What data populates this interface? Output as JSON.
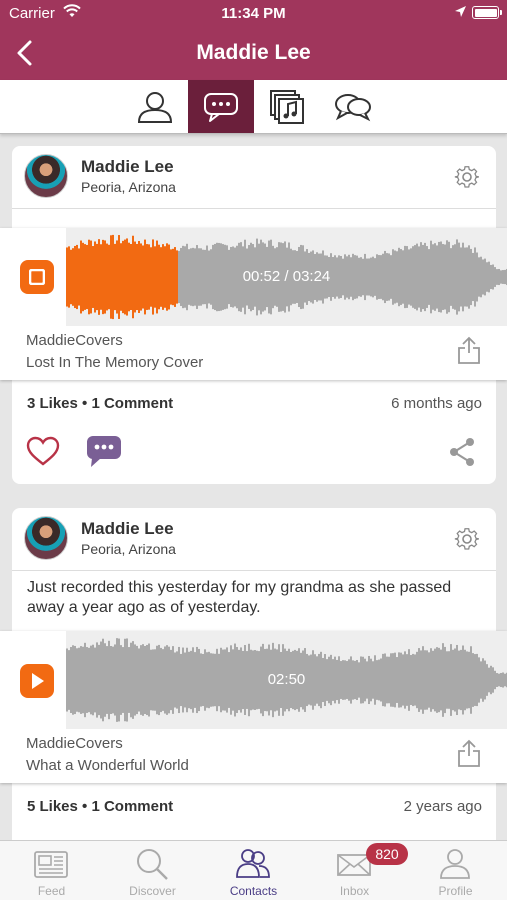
{
  "status_bar": {
    "carrier": "Carrier",
    "time": "11:34 PM"
  },
  "nav": {
    "title": "Maddie Lee"
  },
  "colors": {
    "brand": "#a0365c",
    "tab_active": "#6b1f3b",
    "accent": "#f26a12",
    "link_purple": "#7a5f95"
  },
  "tabs": [
    {
      "icon": "person-icon"
    },
    {
      "icon": "chat-bubble-icon",
      "active": true
    },
    {
      "icon": "music-library-icon"
    },
    {
      "icon": "conversations-icon"
    }
  ],
  "posts": [
    {
      "author": "Maddie Lee",
      "location": "Peoria, Arizona",
      "text": "",
      "time_display": "00:52 / 03:24",
      "progress": 0.25,
      "playing": true,
      "artist": "MaddieCovers",
      "track": "Lost In The Memory Cover",
      "stats": "3 Likes • 1 Comment",
      "ago": "6 months ago"
    },
    {
      "author": "Maddie Lee",
      "location": "Peoria, Arizona",
      "text": "Just recorded this yesterday for my grandma as she passed away a year ago as of yesterday.",
      "time_display": "02:50",
      "progress": 0,
      "playing": false,
      "artist": "MaddieCovers",
      "track": "What a Wonderful World",
      "stats": "5 Likes • 1 Comment",
      "ago": "2 years ago"
    }
  ],
  "tabbar": {
    "items": [
      {
        "label": "Feed",
        "icon": "feed-icon"
      },
      {
        "label": "Discover",
        "icon": "magnifier-icon"
      },
      {
        "label": "Contacts",
        "icon": "contacts-icon",
        "active": true
      },
      {
        "label": "Inbox",
        "icon": "envelope-icon"
      },
      {
        "label": "Profile",
        "icon": "profile-icon"
      }
    ],
    "inbox_badge": "820"
  }
}
